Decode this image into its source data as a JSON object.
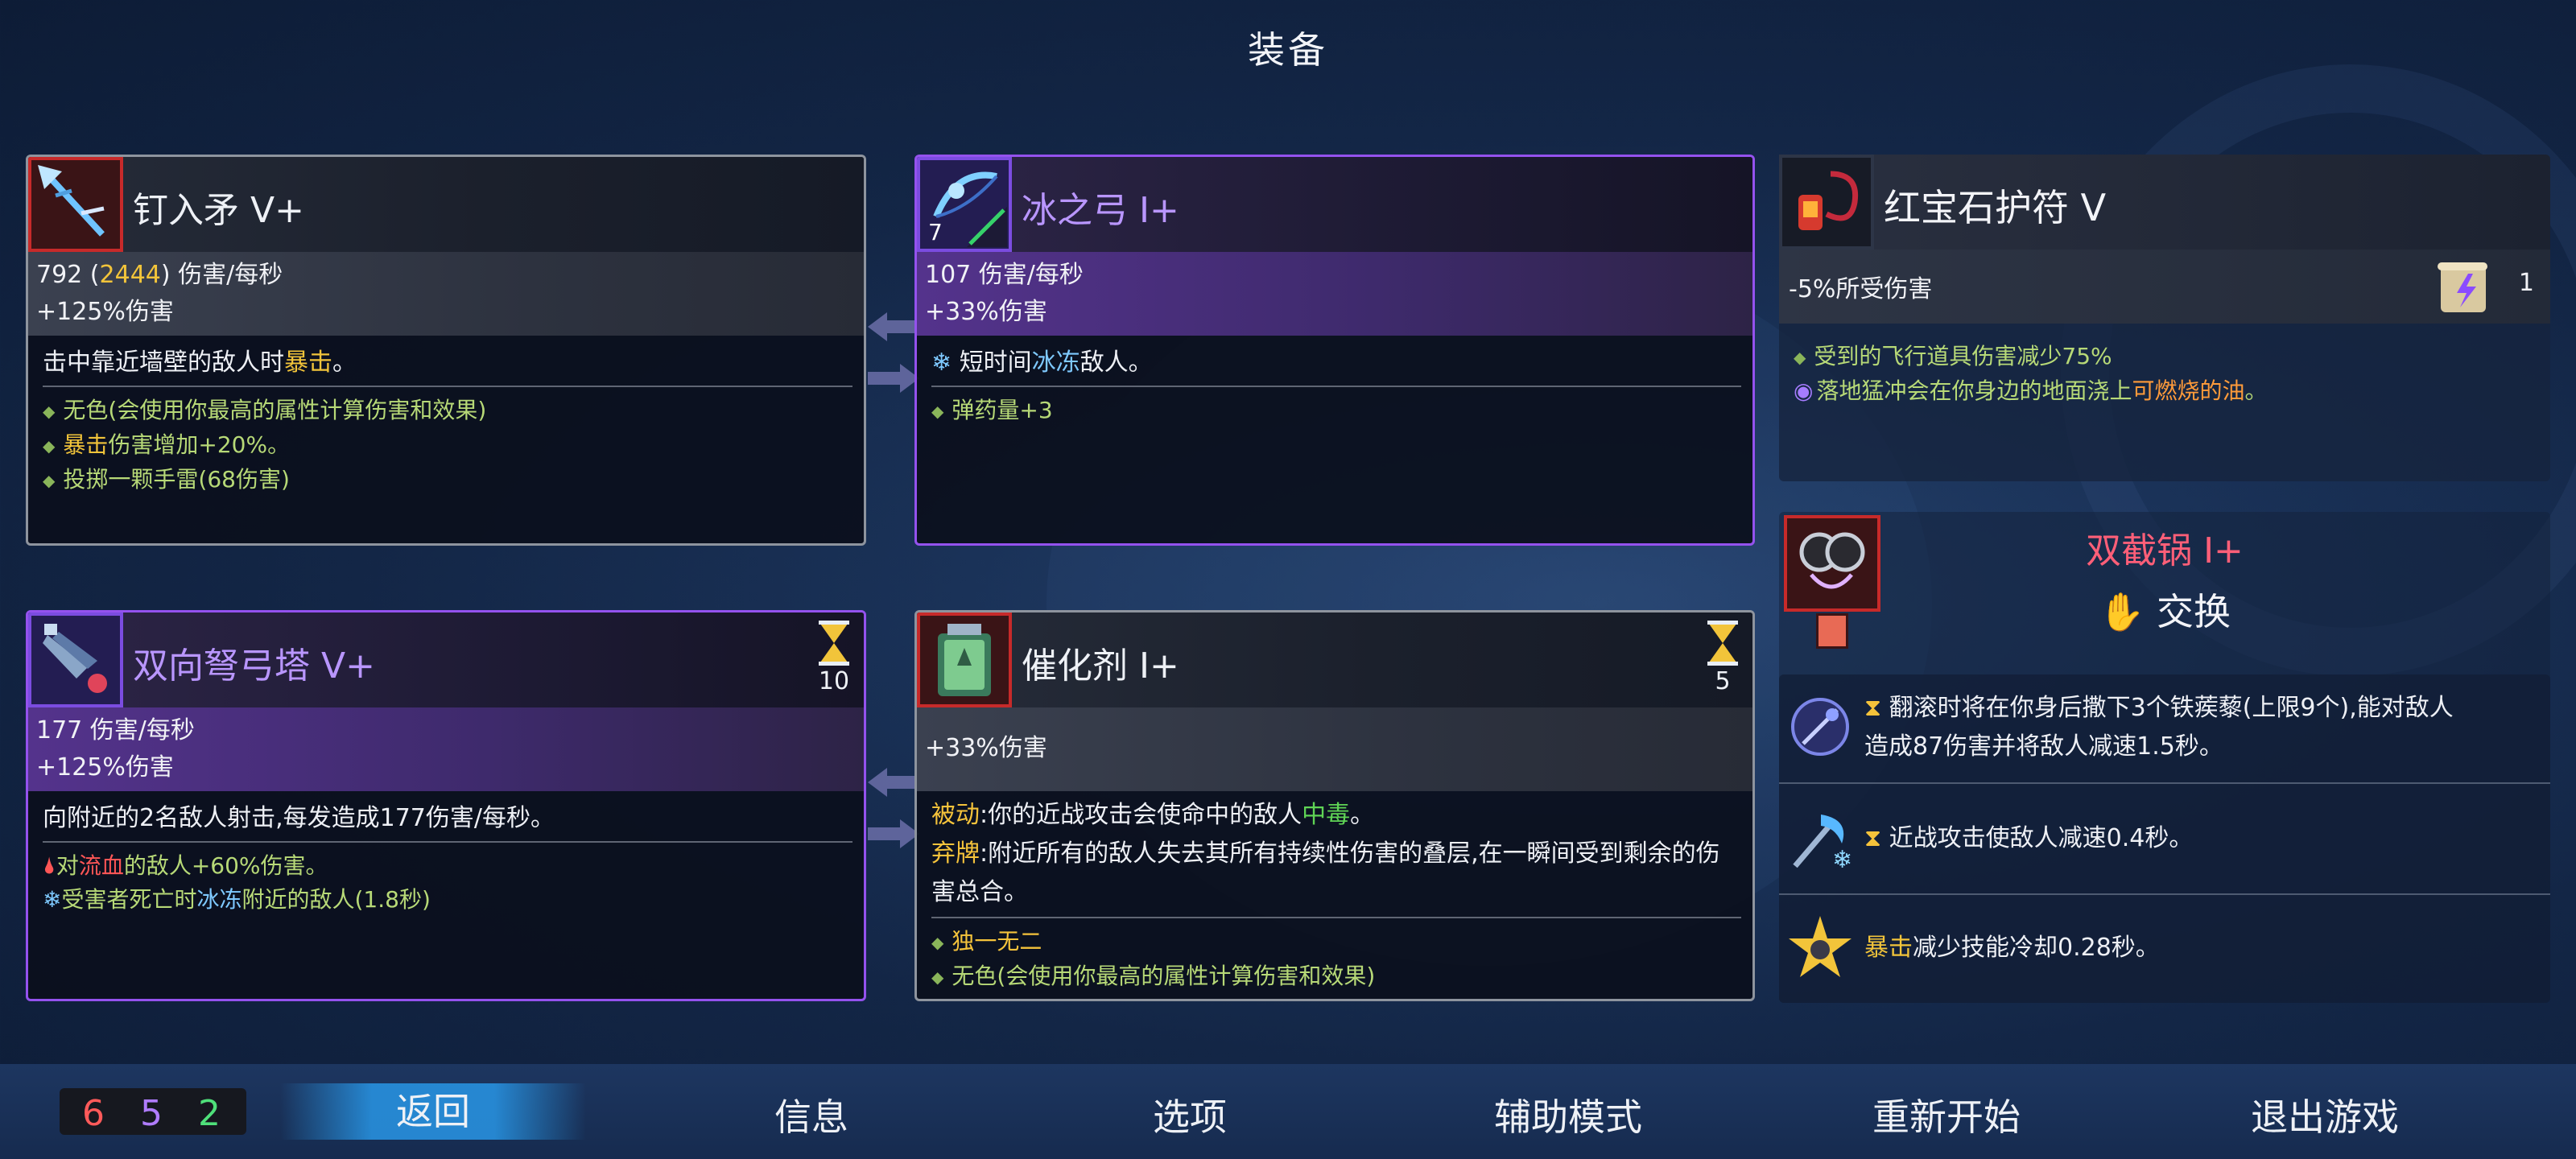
{
  "screen_title": "装备",
  "cards": {
    "melee": {
      "name": "钉入矛 V+",
      "dps_base": "792",
      "dps_crit_open": " (",
      "dps_crit": "2444",
      "dps_crit_close": ")",
      "dps_unit": " 伤害/每秒",
      "bonus": "+125%伤害",
      "main_pre": "击中靠近墙壁的敌人时",
      "main_crit": "暴击",
      "main_post": "。",
      "aff1": "无色(会使用你最高的属性计算伤害和效果)",
      "aff2_crit": "暴击",
      "aff2_post": "伤害增加+20%。",
      "aff3": "投掷一颗手雷(68伤害)"
    },
    "bow": {
      "name": "冰之弓 I+",
      "badge": "7",
      "dps": "107 伤害/每秒",
      "bonus": "+33%伤害",
      "main_pre": "短时间",
      "main_ice": "冰冻",
      "main_post": "敌人。",
      "aff1": "弹药量+3"
    },
    "turret": {
      "name": "双向弩弓塔 V+",
      "timer": "10",
      "dps": "177 伤害/每秒",
      "bonus": "+125%伤害",
      "main": "向附近的2名敌人射击,每发造成177伤害/每秒。",
      "aff1_pre": "对",
      "aff1_red": "流血",
      "aff1_post": "的敌人+60%伤害。",
      "aff2_pre": "受害者死亡时",
      "aff2_ice": "冰冻",
      "aff2_post": "附近的敌人(1.8秒)"
    },
    "catalyst": {
      "name": "催化剂 I+",
      "timer": "5",
      "bonus": "+33%伤害",
      "passive_label": "被动",
      "passive_pre": ":你的近战攻击会使命中的敌人",
      "passive_green": "中毒",
      "passive_post": "。",
      "discard_label": "弃牌",
      "discard_text": ":附近所有的敌人失去其所有持续性伤害的叠层,在一瞬间受到剩余的伤害总合。",
      "aff1": "独一无二",
      "aff2": "无色(会使用你最高的属性计算伤害和效果)"
    }
  },
  "amulet": {
    "name": "红宝石护符 V",
    "stat": "-5%所受伤害",
    "scroll_count": "1",
    "aff1": "受到的飞行道具伤害减少75%",
    "aff2_pre": "落地猛冲会在你身边的地面浇上",
    "aff2_orange": "可燃烧的油",
    "aff2_post": "。"
  },
  "skill": {
    "name": "双截锅 I+",
    "swap_label": "交换"
  },
  "mutations": [
    {
      "icon": "caltrops-icon",
      "text1": "翻滚时将在你身后撒下3个铁蒺藜(上限9个),能对敌人",
      "text2": "造成87伤害并将敌人减速1.5秒。"
    },
    {
      "icon": "frost-axe-icon",
      "text1": "近战攻击使敌人减速0.4秒。"
    },
    {
      "icon": "crit-star-icon",
      "text_crit": "暴击",
      "text1": "减少技能冷却0.28秒。"
    }
  ],
  "scroll_stats": {
    "brutality": "6",
    "tactics": "5",
    "survival": "2"
  },
  "menu": {
    "back": "返回",
    "info": "信息",
    "options": "选项",
    "assist": "辅助模式",
    "restart": "重新开始",
    "quit": "退出游戏"
  },
  "colors": {
    "rare_border": "#9452ee",
    "common_border": "#8e949e",
    "crit_gold": "#f2c43a",
    "ice_blue": "#7ec9ff",
    "poison_green": "#5fd455",
    "bleed_red": "#ff5656",
    "skill_pink": "#ff5f78",
    "brutality_red": "#ff5a5a",
    "tactics_purple": "#b07cff",
    "survival_green": "#4fe07a"
  }
}
